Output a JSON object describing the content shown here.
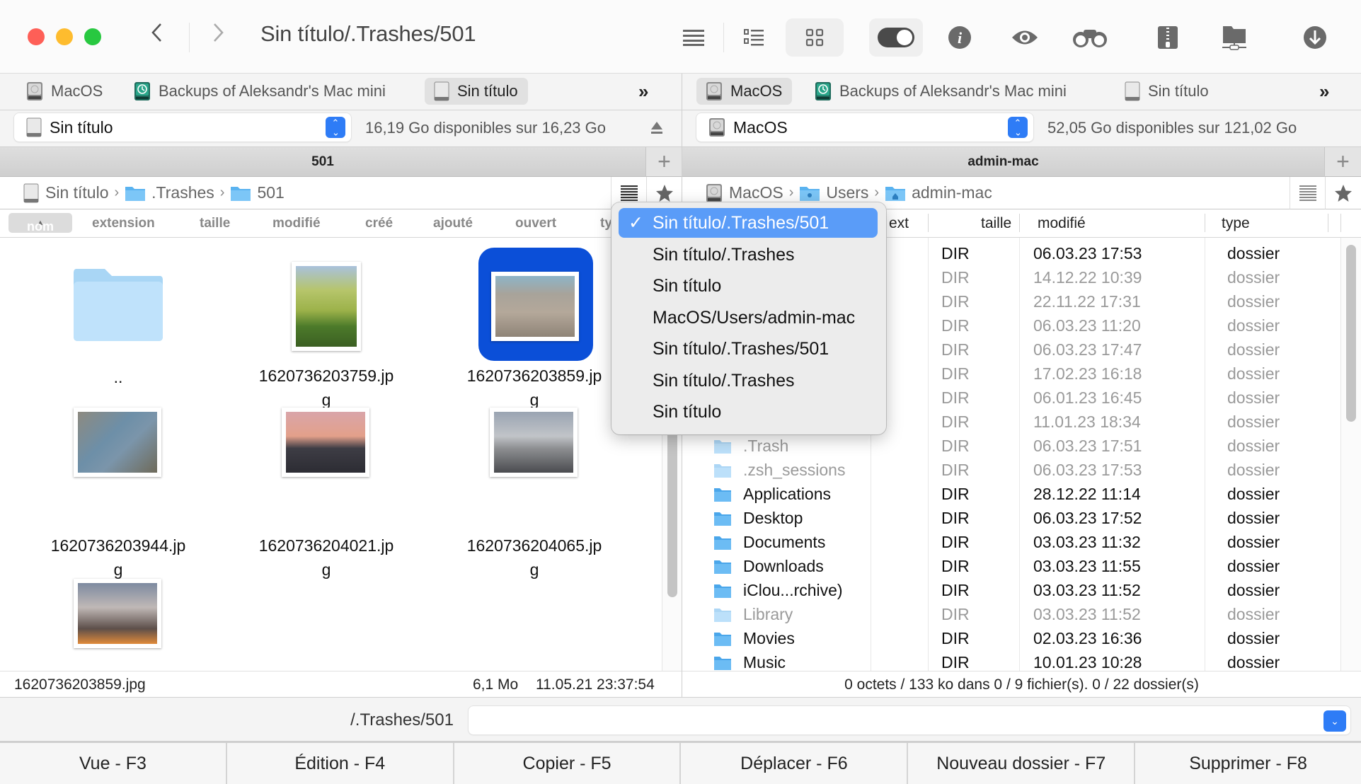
{
  "window": {
    "title": "Sin título/.Trashes/501",
    "colors": {
      "close": "#fe5f57",
      "minimize": "#febc2e",
      "zoom": "#28c840",
      "accent": "#2e7cf6",
      "selection": "#0b4fd8",
      "menu_highlight": "#5a9cf8"
    }
  },
  "toolbar": {
    "back_icon": "chevron-left-icon",
    "forward_icon": "chevron-right-icon",
    "buttons": [
      {
        "icon": "list-view-icon",
        "label": "Liste"
      },
      {
        "icon": "detail-list-icon",
        "label": "Détails"
      },
      {
        "icon": "grid-view-icon",
        "label": "Icônes",
        "active": true
      },
      {
        "icon": "toggle-hidden-icon",
        "label": "Fichiers cachés",
        "active": true
      },
      {
        "icon": "info-icon",
        "label": "Infos"
      },
      {
        "icon": "eye-icon",
        "label": "Aperçu"
      },
      {
        "icon": "binoculars-icon",
        "label": "Rechercher"
      },
      {
        "icon": "archive-zip-icon",
        "label": "Archive"
      },
      {
        "icon": "network-folder-icon",
        "label": "Réseau"
      },
      {
        "icon": "download-icon",
        "label": "Télécharger"
      }
    ]
  },
  "left": {
    "volume_tabs": [
      {
        "label": "MacOS",
        "icon": "hard-drive-icon"
      },
      {
        "label": "Backups of Aleksandr's Mac mini",
        "icon": "time-machine-icon"
      },
      {
        "label": "Sin título",
        "icon": "external-drive-icon",
        "selected": true
      }
    ],
    "more_label": "»",
    "volume": {
      "name": "Sin título",
      "free": "16,19 Go disponibles sur 16,23 Go"
    },
    "header": "501",
    "breadcrumb": [
      "Sin título",
      ".Trashes",
      "501"
    ],
    "columns": [
      "nom",
      "extension",
      "taille",
      "modifié",
      "créé",
      "ajouté",
      "ouvert",
      "ty"
    ],
    "sort_column": "nom",
    "items": [
      {
        "name": "..",
        "kind": "folder"
      },
      {
        "name": "1620736203759.jp\ng",
        "kind": "image",
        "palette": "tree"
      },
      {
        "name": "1620736203859.jp\ng",
        "kind": "image",
        "palette": "shore",
        "selected": true
      },
      {
        "name": "1620736203944.jp\ng",
        "kind": "image",
        "palette": "swans"
      },
      {
        "name": "1620736204021.jp\ng",
        "kind": "image",
        "palette": "sunset"
      },
      {
        "name": "1620736204065.jp\ng",
        "kind": "image",
        "palette": "lake"
      },
      {
        "name": "",
        "kind": "image",
        "palette": "blossom"
      }
    ],
    "status": {
      "file": "1620736203859.jpg",
      "size": "6,1 Mo",
      "date": "11.05.21 23:37:54"
    }
  },
  "right": {
    "volume_tabs": [
      {
        "label": "MacOS",
        "icon": "hard-drive-icon",
        "selected": true
      },
      {
        "label": "Backups of Aleksandr's Mac mini",
        "icon": "time-machine-icon"
      },
      {
        "label": "Sin título",
        "icon": "external-drive-icon"
      }
    ],
    "more_label": "»",
    "volume": {
      "name": "MacOS",
      "free": "52,05 Go disponibles sur 121,02 Go"
    },
    "header": "admin-mac",
    "breadcrumb": [
      "MacOS",
      "Users",
      "admin-mac"
    ],
    "columns": {
      "ext": "ext",
      "size": "taille",
      "modified": "modifié",
      "type": "type"
    },
    "rows": [
      {
        "name": "",
        "size": "DIR",
        "modified": "06.03.23 17:53",
        "type": "dossier",
        "dim": false
      },
      {
        "name": "",
        "size": "DIR",
        "modified": "14.12.22 10:39",
        "type": "dossier",
        "dim": true
      },
      {
        "name": "",
        "size": "DIR",
        "modified": "22.11.22 17:31",
        "type": "dossier",
        "dim": true
      },
      {
        "name": "",
        "size": "DIR",
        "modified": "06.03.23 11:20",
        "type": "dossier",
        "dim": true
      },
      {
        "name": "",
        "size": "DIR",
        "modified": "06.03.23 17:47",
        "type": "dossier",
        "dim": true
      },
      {
        "name": "",
        "size": "DIR",
        "modified": "17.02.23 16:18",
        "type": "dossier",
        "dim": true
      },
      {
        "name": "",
        "size": "DIR",
        "modified": "06.01.23 16:45",
        "type": "dossier",
        "dim": true
      },
      {
        "name": "",
        "size": "DIR",
        "modified": "11.01.23 18:34",
        "type": "dossier",
        "dim": true
      },
      {
        "name": ".Trash",
        "size": "DIR",
        "modified": "06.03.23 17:51",
        "type": "dossier",
        "dim": true
      },
      {
        "name": ".zsh_sessions",
        "size": "DIR",
        "modified": "06.03.23 17:53",
        "type": "dossier",
        "dim": true
      },
      {
        "name": "Applications",
        "size": "DIR",
        "modified": "28.12.22 11:14",
        "type": "dossier",
        "dim": false
      },
      {
        "name": "Desktop",
        "size": "DIR",
        "modified": "06.03.23 17:52",
        "type": "dossier",
        "dim": false
      },
      {
        "name": "Documents",
        "size": "DIR",
        "modified": "03.03.23 11:32",
        "type": "dossier",
        "dim": false
      },
      {
        "name": "Downloads",
        "size": "DIR",
        "modified": "03.03.23 11:55",
        "type": "dossier",
        "dim": false
      },
      {
        "name": "iClou...rchive)",
        "size": "DIR",
        "modified": "03.03.23 11:52",
        "type": "dossier",
        "dim": false
      },
      {
        "name": "Library",
        "size": "DIR",
        "modified": "03.03.23 11:52",
        "type": "dossier",
        "dim": true
      },
      {
        "name": "Movies",
        "size": "DIR",
        "modified": "02.03.23 16:36",
        "type": "dossier",
        "dim": false
      },
      {
        "name": "Music",
        "size": "DIR",
        "modified": "10.01.23 10:28",
        "type": "dossier",
        "dim": false
      }
    ],
    "status": "0 octets / 133 ko dans 0 / 9 fichier(s). 0 / 22 dossier(s)"
  },
  "history_menu": {
    "items": [
      {
        "label": "Sin título/.Trashes/501",
        "checked": true
      },
      {
        "label": "Sin título/.Trashes"
      },
      {
        "label": "Sin título"
      },
      {
        "label": "MacOS/Users/admin-mac"
      },
      {
        "label": "Sin título/.Trashes/501"
      },
      {
        "label": "Sin título/.Trashes"
      },
      {
        "label": "Sin título"
      }
    ],
    "check_glyph": "✓"
  },
  "command_line": {
    "prompt": "/.Trashes/501",
    "value": "",
    "placeholder": ""
  },
  "function_keys": [
    "Vue - F3",
    "Édition - F4",
    "Copier - F5",
    "Déplacer - F6",
    "Nouveau dossier - F7",
    "Supprimer - F8"
  ]
}
